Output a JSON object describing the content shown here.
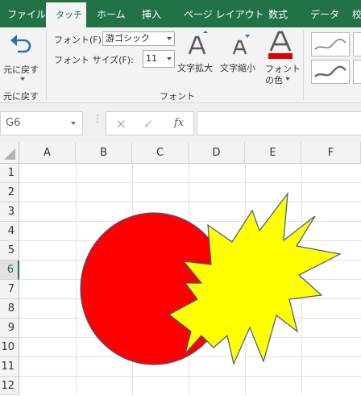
{
  "tabs": [
    {
      "label": "ファイル",
      "active": false
    },
    {
      "label": "タッチ",
      "active": true
    },
    {
      "label": "ホーム",
      "active": false
    },
    {
      "label": "挿入",
      "active": false
    },
    {
      "label": "ページ レイアウト",
      "active": false
    },
    {
      "label": "数式",
      "active": false
    },
    {
      "label": "データ",
      "active": false
    },
    {
      "label": "校",
      "active": false
    }
  ],
  "ribbon": {
    "undo_label_line1": "元に戻す",
    "undo_group_label": "元に戻す",
    "font_label": "フォント(F):",
    "font_value": "游ゴシック",
    "font_size_label": "フォント サイズ(F):",
    "font_size_value": "11",
    "grow_label": "文字拡大",
    "shrink_label": "文字縮小",
    "font_color_line1": "フォント",
    "font_color_line2": "の色",
    "font_group_label": "フォント",
    "font_color_swatch": "#e00000"
  },
  "formula_bar": {
    "name_box": "G6",
    "cancel_icon": "close-icon",
    "enter_icon": "check-icon",
    "fx_label": "fx"
  },
  "grid": {
    "columns": [
      "A",
      "B",
      "C",
      "D",
      "E",
      "F"
    ],
    "rows": [
      "1",
      "2",
      "3",
      "4",
      "5",
      "6",
      "7",
      "8",
      "9",
      "10",
      "11",
      "12"
    ],
    "selected_row": "6"
  },
  "shapes": {
    "circle_fill": "#ff0000",
    "star_fill": "#ffff00",
    "outline": "#3c5a86"
  },
  "colors": {
    "accent": "#217346"
  }
}
